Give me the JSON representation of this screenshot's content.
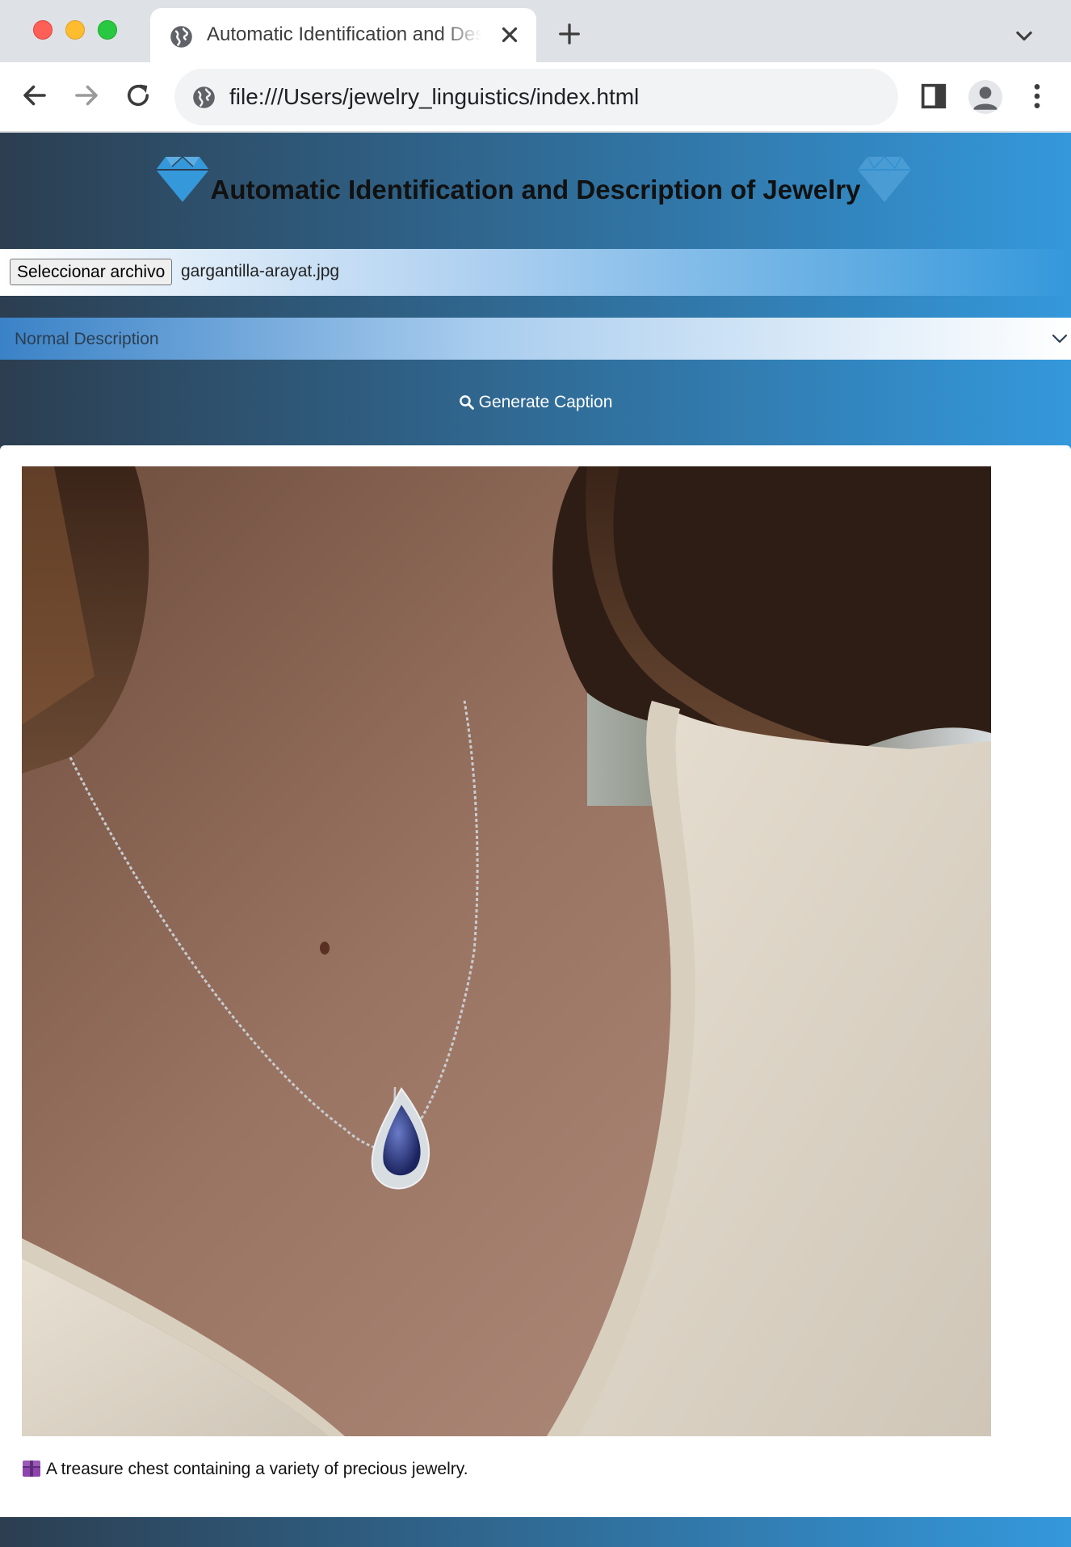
{
  "browser": {
    "tab_title": "Automatic Identification and Description of Jewelry",
    "url": "file:///Users/jewelry_linguistics/index.html"
  },
  "page": {
    "title": "Automatic Identification and Description of Jewelry",
    "file_input": {
      "button_label": "Seleccionar archivo",
      "file_name": "gargantilla-arayat.jpg"
    },
    "description_select": {
      "selected": "Normal Description"
    },
    "generate_button_label": "Generate Caption",
    "result": {
      "image_alt": "gargantilla-arayat.jpg",
      "caption_icon": "gift-icon",
      "caption": "A treasure chest containing a variety of precious jewelry."
    }
  },
  "colors": {
    "gradient_dark": "#2c3e50",
    "gradient_light": "#3498db",
    "gem_blue": "#3498db"
  }
}
